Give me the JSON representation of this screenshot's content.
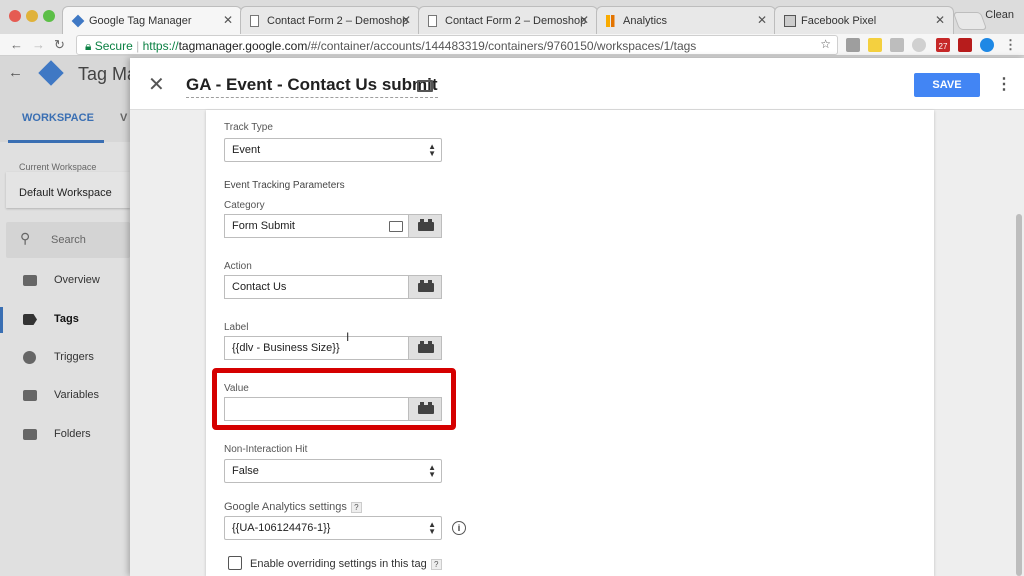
{
  "browser": {
    "tabs": [
      {
        "title": "Google Tag Manager",
        "active": true
      },
      {
        "title": "Contact Form 2 – Demoshop",
        "active": false
      },
      {
        "title": "Contact Form 2 – Demoshop",
        "active": false
      },
      {
        "title": "Analytics",
        "active": false
      },
      {
        "title": "Facebook Pixel",
        "active": false
      }
    ],
    "profile_label": "Clean",
    "secure_label": "Secure",
    "url_scheme": "https://",
    "url_host": "tagmanager.google.com",
    "url_path": "/#/container/accounts/144483319/containers/9760150/workspaces/1/tags",
    "extension_badge": "27"
  },
  "gtm": {
    "app_title": "Tag Ma",
    "tabs": {
      "workspace": "WORKSPACE",
      "versions": "V"
    },
    "current_workspace_label": "Current Workspace",
    "current_workspace": "Default Workspace",
    "search_placeholder": "Search",
    "nav": [
      {
        "label": "Overview",
        "icon": "overview-icon"
      },
      {
        "label": "Tags",
        "icon": "tag-icon",
        "active": true
      },
      {
        "label": "Triggers",
        "icon": "trigger-icon"
      },
      {
        "label": "Variables",
        "icon": "variables-icon"
      },
      {
        "label": "Folders",
        "icon": "folder-icon"
      }
    ]
  },
  "editor": {
    "tag_name": "GA - Event - Contact Us submit",
    "save_label": "SAVE",
    "track_type": {
      "label": "Track Type",
      "value": "Event"
    },
    "params_heading": "Event Tracking Parameters",
    "category": {
      "label": "Category",
      "value": "Form Submit"
    },
    "action": {
      "label": "Action",
      "value": "Contact Us"
    },
    "label": {
      "label": "Label",
      "value": "{{dlv - Business Size}}"
    },
    "value": {
      "label": "Value",
      "value": ""
    },
    "non_interaction": {
      "label": "Non-Interaction Hit",
      "value": "False"
    },
    "ga_settings": {
      "label": "Google Analytics settings",
      "value": "{{UA-106124476-1}}",
      "help": "?"
    },
    "override": {
      "label": "Enable overriding settings in this tag",
      "help": "?",
      "checked": false
    }
  },
  "colors": {
    "accent": "#4285f4",
    "highlight": "#d50000",
    "secure": "#0b8043"
  }
}
